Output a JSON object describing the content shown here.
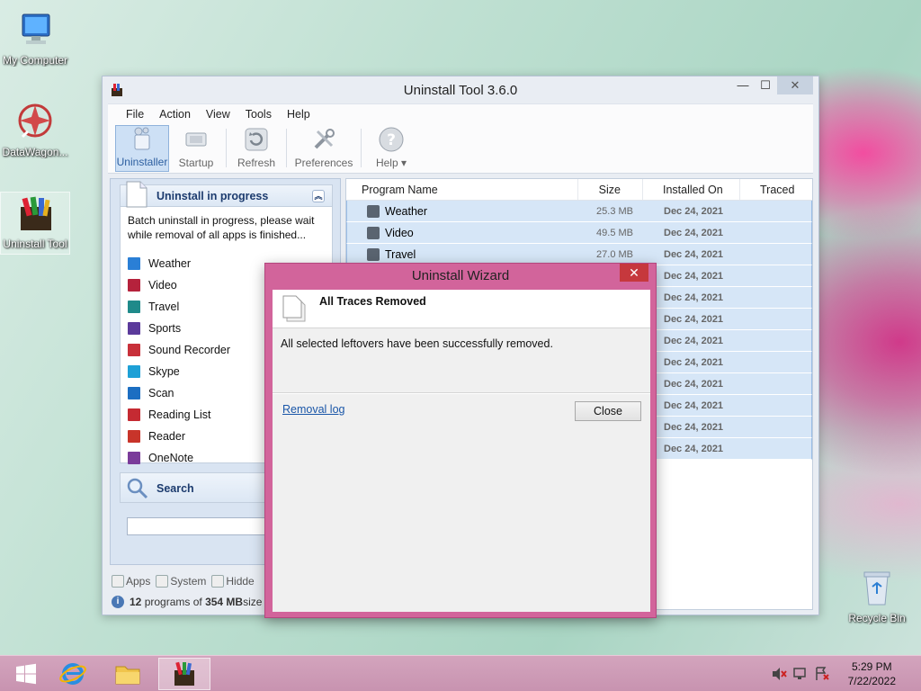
{
  "desktop": {
    "icons": [
      {
        "label": "My Computer"
      },
      {
        "label": "DataWagon..."
      },
      {
        "label": "Uninstall Tool"
      },
      {
        "label": "Recycle Bin"
      }
    ]
  },
  "window": {
    "title": "Uninstall Tool 3.6.0",
    "menu": [
      "File",
      "Action",
      "View",
      "Tools",
      "Help"
    ],
    "toolbar": [
      {
        "label": "Uninstaller",
        "icon": "uninstaller-icon"
      },
      {
        "label": "Startup",
        "icon": "startup-icon"
      },
      {
        "label": "Refresh",
        "icon": "refresh-icon"
      },
      {
        "label": "Preferences",
        "icon": "preferences-icon"
      },
      {
        "label": "Help ▾",
        "icon": "help-icon"
      }
    ]
  },
  "left_panel": {
    "progress_title": "Uninstall in progress",
    "progress_text": "Batch uninstall in progress, please wait while removal of all apps is finished...",
    "apps": [
      {
        "name": "Weather",
        "color": "#2a7fd6"
      },
      {
        "name": "Video",
        "color": "#b5223c"
      },
      {
        "name": "Travel",
        "color": "#1f8a8a"
      },
      {
        "name": "Sports",
        "color": "#5b3a9b"
      },
      {
        "name": "Sound Recorder",
        "color": "#c8303a"
      },
      {
        "name": "Skype",
        "color": "#1ea0d6"
      },
      {
        "name": "Scan",
        "color": "#1c6ec2"
      },
      {
        "name": "Reading List",
        "color": "#c52a32"
      },
      {
        "name": "Reader",
        "color": "#c8342a"
      },
      {
        "name": "OneNote",
        "color": "#7a3b9a"
      }
    ],
    "search_title": "Search",
    "search_value": ""
  },
  "filters": {
    "apps": "Apps",
    "system": "System",
    "hidden": "Hidde"
  },
  "status": {
    "count": "12",
    "mid": " programs of ",
    "size": "354 MB",
    "tail": " size"
  },
  "table": {
    "headers": {
      "name": "Program Name",
      "size": "Size",
      "installed": "Installed On",
      "traced": "Traced"
    },
    "rows": [
      {
        "name": "Weather",
        "size": "25.3 MB",
        "installed": "Dec 24, 2021"
      },
      {
        "name": "Video",
        "size": "49.5 MB",
        "installed": "Dec 24, 2021"
      },
      {
        "name": "Travel",
        "size": "27.0 MB",
        "installed": "Dec 24, 2021"
      },
      {
        "name": "",
        "size": "",
        "installed": "Dec 24, 2021"
      },
      {
        "name": "",
        "size": "",
        "installed": "Dec 24, 2021"
      },
      {
        "name": "",
        "size": "",
        "installed": "Dec 24, 2021"
      },
      {
        "name": "",
        "size": "",
        "installed": "Dec 24, 2021"
      },
      {
        "name": "",
        "size": "",
        "installed": "Dec 24, 2021"
      },
      {
        "name": "",
        "size": "",
        "installed": "Dec 24, 2021"
      },
      {
        "name": "",
        "size": "",
        "installed": "Dec 24, 2021"
      },
      {
        "name": "",
        "size": "",
        "installed": "Dec 24, 2021"
      },
      {
        "name": "",
        "size": "",
        "installed": "Dec 24, 2021"
      }
    ]
  },
  "dialog": {
    "title": "Uninstall Wizard",
    "heading": "All Traces Removed",
    "message": "All selected leftovers have been successfully removed.",
    "link": "Removal log",
    "button": "Close"
  },
  "taskbar": {
    "time": "5:29 PM",
    "date": "7/22/2022"
  }
}
